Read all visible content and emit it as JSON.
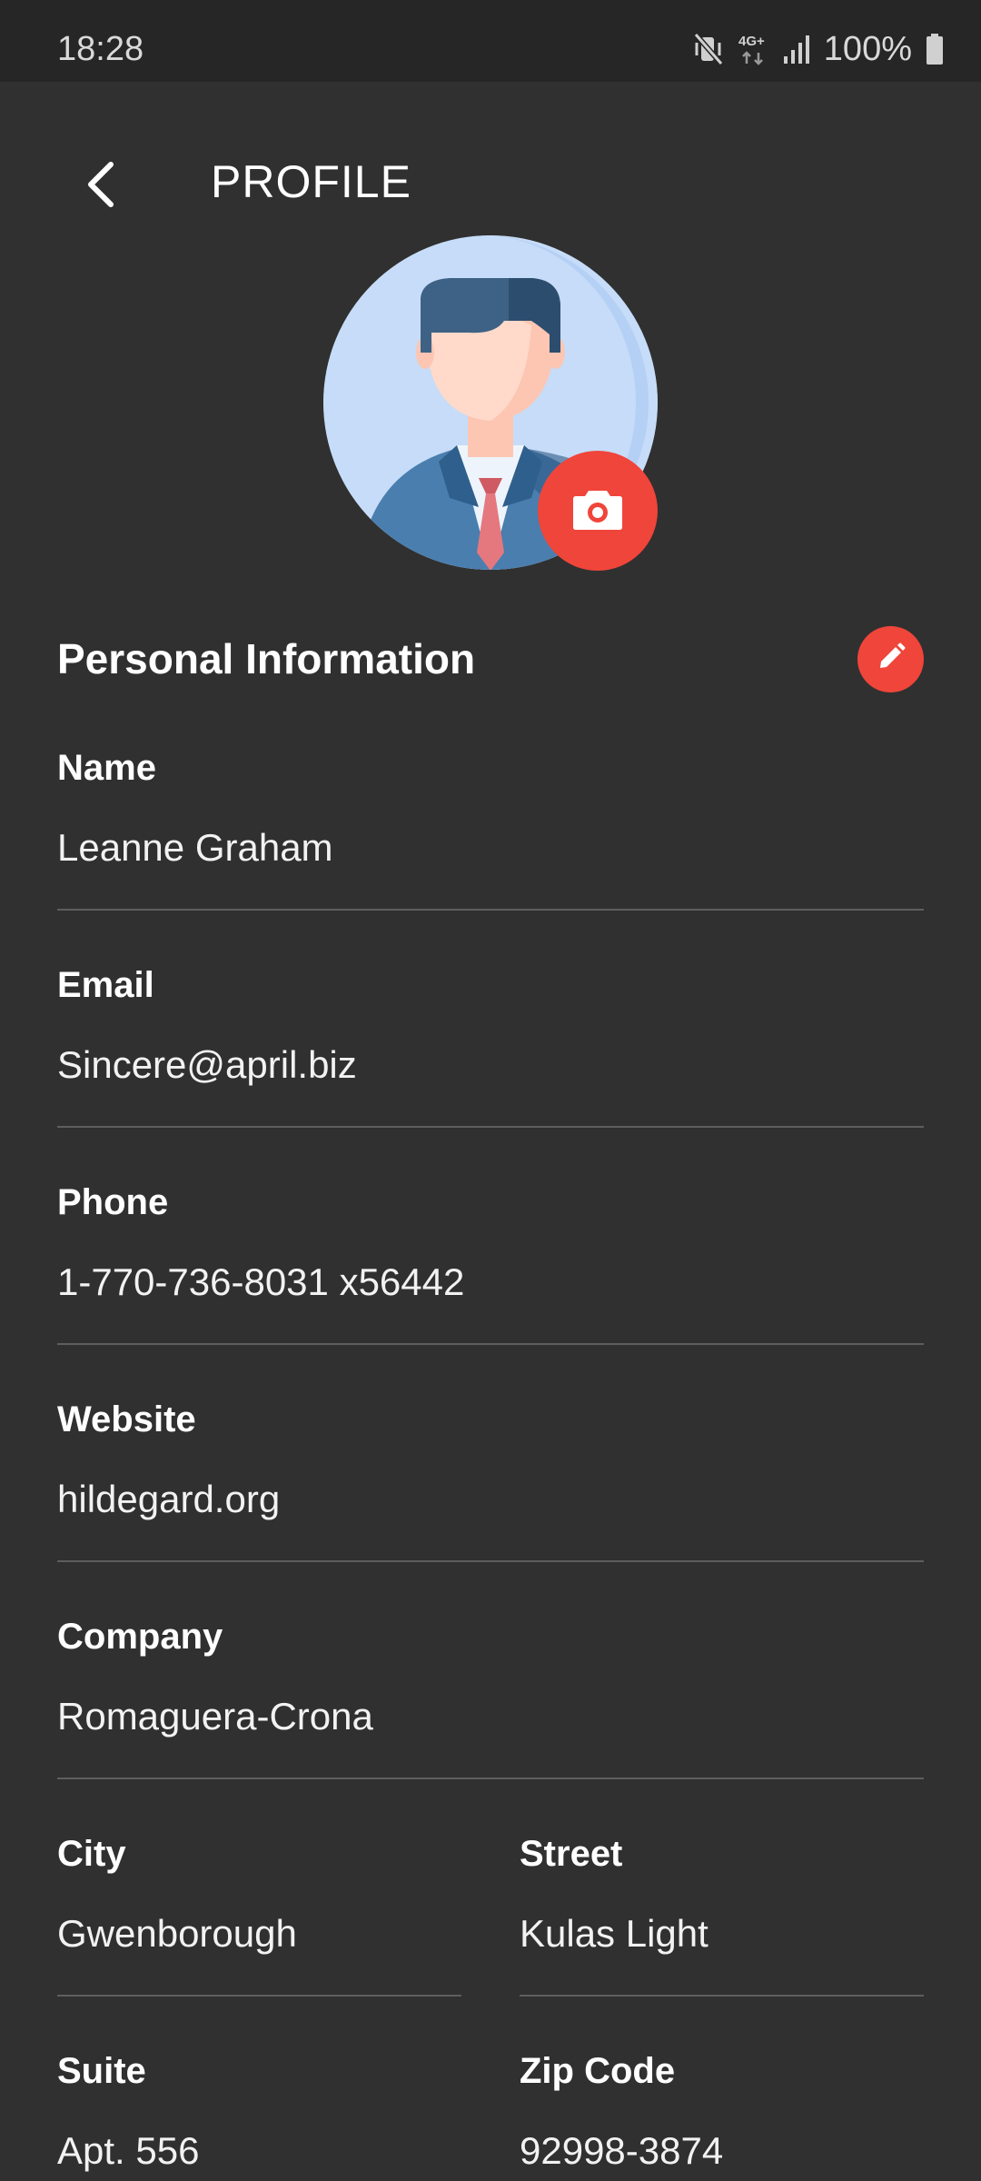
{
  "status_bar": {
    "time": "18:28",
    "battery": "100%",
    "icons": [
      "mute-vibrate-icon",
      "4g-plus-icon",
      "signal-icon",
      "battery-icon"
    ]
  },
  "header": {
    "title": "PROFILE",
    "back_icon": "chevron-left-icon"
  },
  "avatar": {
    "icon": "businessman-avatar",
    "camera_icon": "camera-icon"
  },
  "section": {
    "title": "Personal Information",
    "edit_icon": "pencil-icon"
  },
  "fields": {
    "name": {
      "label": "Name",
      "value": "Leanne Graham"
    },
    "email": {
      "label": "Email",
      "value": "Sincere@april.biz"
    },
    "phone": {
      "label": "Phone",
      "value": "1-770-736-8031 x56442"
    },
    "website": {
      "label": "Website",
      "value": "hildegard.org"
    },
    "company": {
      "label": "Company",
      "value": "Romaguera-Crona"
    },
    "city": {
      "label": "City",
      "value": "Gwenborough"
    },
    "street": {
      "label": "Street",
      "value": "Kulas Light"
    },
    "suite": {
      "label": "Suite",
      "value": "Apt. 556"
    },
    "zipcode": {
      "label": "Zip Code",
      "value": "92998-3874"
    }
  },
  "colors": {
    "background": "#303030",
    "status_bar": "#262626",
    "accent": "#f0453a",
    "divider": "#5e5e5e"
  }
}
